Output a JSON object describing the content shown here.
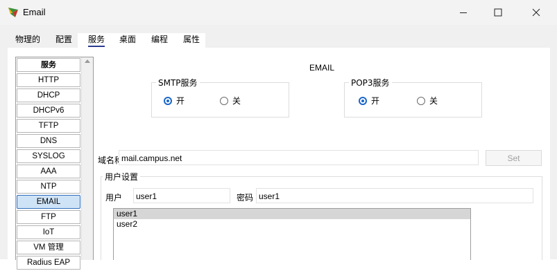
{
  "window": {
    "title": "Email"
  },
  "tabs": [
    {
      "label": "物理的"
    },
    {
      "label": "配置"
    },
    {
      "label": "服务",
      "active": true
    },
    {
      "label": "桌面"
    },
    {
      "label": "编程"
    },
    {
      "label": "属性"
    }
  ],
  "sidebar": {
    "items": [
      {
        "label": "服务",
        "header": true
      },
      {
        "label": "HTTP"
      },
      {
        "label": "DHCP"
      },
      {
        "label": "DHCPv6"
      },
      {
        "label": "TFTP"
      },
      {
        "label": "DNS"
      },
      {
        "label": "SYSLOG"
      },
      {
        "label": "AAA"
      },
      {
        "label": "NTP"
      },
      {
        "label": "EMAIL",
        "selected": true
      },
      {
        "label": "FTP"
      },
      {
        "label": "IoT"
      },
      {
        "label": "VM 管理"
      },
      {
        "label": "Radius EAP"
      }
    ]
  },
  "email": {
    "title": "EMAIL",
    "smtp": {
      "legend": "SMTP服务",
      "on_label": "开",
      "off_label": "关",
      "selected": "on"
    },
    "pop3": {
      "legend": "POP3服务",
      "on_label": "开",
      "off_label": "关",
      "selected": "on"
    },
    "domain_label": "域名称:",
    "domain_value": "mail.campus.net",
    "set_button": "Set",
    "user_settings": {
      "legend": "用户设置",
      "user_label": "用户",
      "user_value": "user1",
      "password_label": "密码",
      "password_value": "user1",
      "users": [
        "user1",
        "user2"
      ],
      "selected_user": "user1"
    }
  },
  "colors": {
    "accent": "#1a66c9",
    "selected_tab_underline": "#2b3a8f",
    "selected_side_bg": "#cfe3f7"
  }
}
